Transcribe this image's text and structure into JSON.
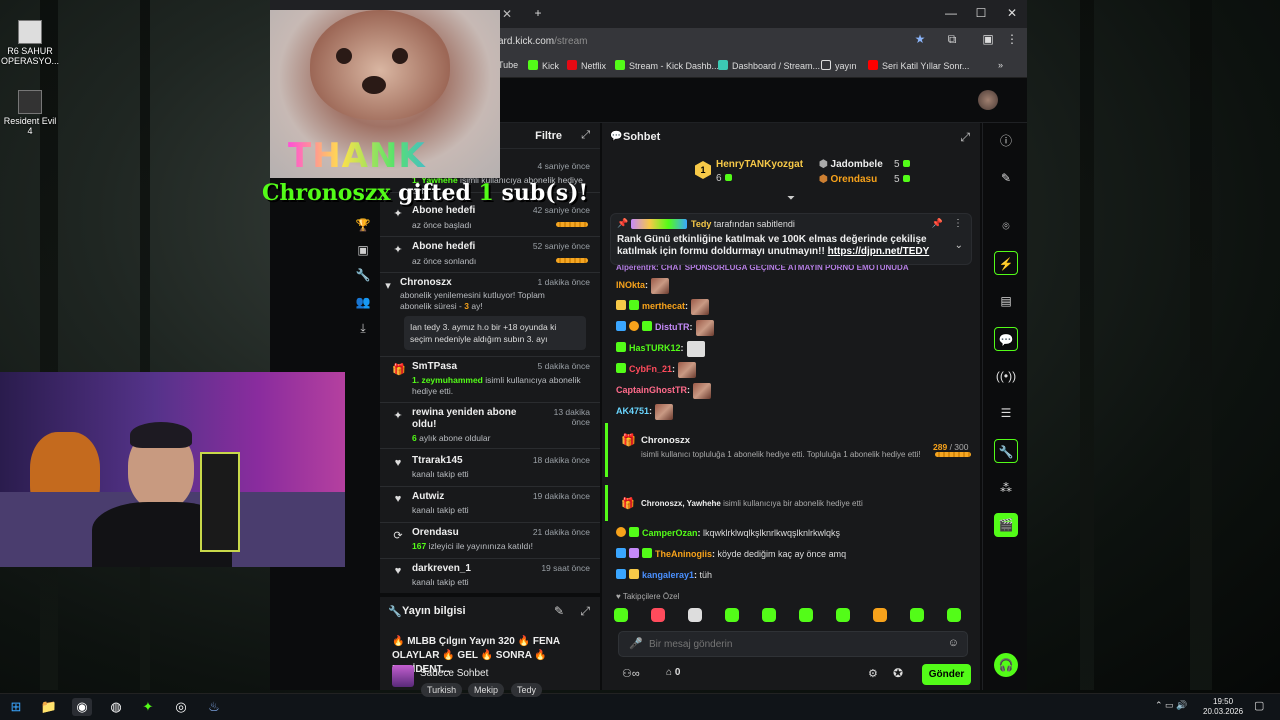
{
  "desktop": {
    "icons": [
      {
        "label": "R6 SAHUR OPERASYO..."
      },
      {
        "label": "Resident Evil 4"
      }
    ]
  },
  "browser": {
    "url_base": "ard.kick.com",
    "url_path": "/stream",
    "bookmarks": [
      "Tube",
      "Kick",
      "Netflix",
      "Stream - Kick Dashb...",
      "Dashboard / Stream...",
      "yayın",
      "Seri Katil Yıllar Sonr..."
    ]
  },
  "overlay": {
    "thank_you": "THANK YOU",
    "gift_user": "Chronoszx",
    "gift_text1": "gifted",
    "gift_count": "1",
    "gift_text2": "sub(s)!"
  },
  "activity": {
    "filter_label": "Filtre",
    "items": [
      {
        "icon": "gift-icon",
        "name": "",
        "time": "4 saniye önce",
        "sub_highlight": "1. Yawhehe",
        "sub": " isimli kullanıcıya abonelik hediye etti."
      },
      {
        "icon": "target-icon",
        "name": "Abone hedefi",
        "time": "42 saniye önce",
        "sub": "az önce başladı"
      },
      {
        "icon": "target-icon",
        "name": "Abone hedefi",
        "time": "52 saniye önce",
        "sub": "az önce sonlandı"
      },
      {
        "icon": "star-icon",
        "name": "Chronoszx",
        "time": "1 dakika önce",
        "sub": "abonelik yenilemesini kutluyor! Toplam abonelik süresi - ",
        "sub_highlight": "3",
        "sub_end": " ay!",
        "quote": "Ian tedy 3. aymız h.o bir +18 oyunda ki seçim nedeniyle aldığım subın 3. ayı"
      },
      {
        "icon": "gift-icon",
        "name": "SmTPasa",
        "time": "5 dakika önce",
        "sub_highlight": "1. zeymuhammed",
        "sub": " isimli kullanıcıya abonelik hediye etti."
      },
      {
        "icon": "star-icon",
        "name": "rewina yeniden abone oldu!",
        "time": "13 dakika önce",
        "sub_highlight": "6",
        "sub": " aylık abone oldular"
      },
      {
        "icon": "heart-icon",
        "name": "Ttrarak145",
        "time": "18 dakika önce",
        "sub": "kanalı takip etti"
      },
      {
        "icon": "heart-icon",
        "name": "Autwiz",
        "time": "19 dakika önce",
        "sub": "kanalı takip etti"
      },
      {
        "icon": "raid-icon",
        "name": "Orendasu",
        "time": "21 dakika önce",
        "sub_highlight": "167",
        "sub": " izleyici ile yayınınıza katıldı!"
      },
      {
        "icon": "heart-icon",
        "name": "darkreven_1",
        "time": "19 saat önce",
        "sub": "kanalı takip etti"
      }
    ]
  },
  "stream_info": {
    "title": "Yayın bilgisi",
    "text": "🔥 MLBB Çılgın Yayın 320 🔥 FENA OLAYLAR 🔥 GEL 🔥 SONRA 🔥 RESİDENT...",
    "mode": "Sadece Sohbet",
    "tags": [
      "Turkish",
      "Mekip",
      "Tedy"
    ]
  },
  "chat": {
    "title": "Sohbet",
    "leaderboard": [
      {
        "rank": "1",
        "name": "HenryTANKyozgat",
        "count": "6"
      },
      {
        "name": "Jadombele",
        "count": "5"
      },
      {
        "name": "Orendasu",
        "count": "5"
      }
    ],
    "pinned": {
      "by_user": "Tedy",
      "by_text": "tarafından sabitlendi",
      "message": "Rank Günü etkinliğine katılmak ve 100K elmas değerinde çekilişe katılmak için formu doldurmayı unutmayın!!",
      "link": "https://djpn.net/TEDY"
    },
    "scrolled_line": "Alperentrk: CHAT SPONSORLUĞA GEÇİNCE ATMAYIN PORNO EMOTUNUDA",
    "emote_messages": [
      {
        "user": "INOkta",
        "color": "#f7a21b"
      },
      {
        "user": "merthecat",
        "color": "#f7a21b"
      },
      {
        "user": "DistuTR",
        "color": "#c58af9"
      },
      {
        "user": "HasTURK12",
        "color": "#53fc18"
      },
      {
        "user": "CybFn_21",
        "color": "#ff4b5c"
      },
      {
        "user": "CaptainGhostTR",
        "color": "#ff6b8b"
      },
      {
        "user": "AK4751",
        "color": "#6ad6ff"
      }
    ],
    "gift_event": {
      "user": "Chronoszx",
      "text": "isimli kullanıcı topluluğa 1 abonelik hediye etti. Topluluğa 1 abonelik hediye etti!",
      "progress": "289",
      "goal": "/ 300"
    },
    "gift_line": {
      "users": "Chronoszx, Yawhehe",
      "text": "isimli kullanıcıya bir abonelik hediye etti"
    },
    "messages": [
      {
        "user": "CamperOzan",
        "color": "#53fc18",
        "text": "lkqwklrklwqlkşlknrlkwqşlknlrkwlqkş"
      },
      {
        "user": "TheAninogiis",
        "color": "#f7a21b",
        "text": "köyde dediğim kaç ay önce amq"
      },
      {
        "user": "kangaleray1",
        "color": "#4a90ff",
        "text": "tüh"
      }
    ],
    "followers_only": "Takipçilere Özel",
    "placeholder": "Bir mesaj gönderin",
    "viewer_count": "0",
    "send_label": "Gönder"
  },
  "taskbar": {
    "time": "19:50",
    "date": "20.03.2026"
  },
  "colors": {
    "accent": "#53fc18",
    "panel": "#18191b",
    "bg": "#0b0c0d"
  }
}
